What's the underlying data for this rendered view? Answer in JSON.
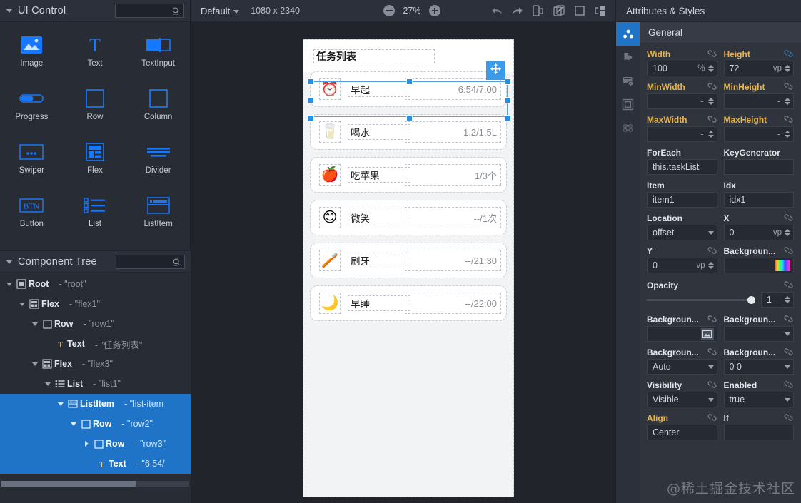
{
  "left_panel": {
    "title": "UI Control",
    "search_placeholder": "",
    "search_value": "",
    "controls": [
      {
        "name": "Image",
        "icon": "image-icon"
      },
      {
        "name": "Text",
        "icon": "text-icon"
      },
      {
        "name": "TextInput",
        "icon": "textinput-icon"
      },
      {
        "name": "Progress",
        "icon": "progress-icon"
      },
      {
        "name": "Row",
        "icon": "row-icon"
      },
      {
        "name": "Column",
        "icon": "column-icon"
      },
      {
        "name": "Swiper",
        "icon": "swiper-icon"
      },
      {
        "name": "Flex",
        "icon": "flex-icon"
      },
      {
        "name": "Divider",
        "icon": "divider-icon"
      },
      {
        "name": "Button",
        "icon": "button-icon"
      },
      {
        "name": "List",
        "icon": "list-icon"
      },
      {
        "name": "ListItem",
        "icon": "listitem-icon"
      }
    ]
  },
  "component_tree": {
    "title": "Component Tree",
    "search_value": "",
    "nodes": [
      {
        "type": "Root",
        "id": "- \"root\"",
        "depth": 0,
        "caret": "down",
        "icon": "root-icon",
        "selected": false
      },
      {
        "type": "Flex",
        "id": "- \"flex1\"",
        "depth": 1,
        "caret": "down",
        "icon": "flex-icon",
        "selected": false
      },
      {
        "type": "Row",
        "id": "- \"row1\"",
        "depth": 2,
        "caret": "down",
        "icon": "row-icon",
        "selected": false
      },
      {
        "type": "Text",
        "id": "- \"任务列表\"",
        "depth": 3,
        "caret": "none",
        "icon": "text-icon",
        "selected": false
      },
      {
        "type": "Flex",
        "id": "- \"flex3\"",
        "depth": 2,
        "caret": "down",
        "icon": "flex-icon",
        "selected": false
      },
      {
        "type": "List",
        "id": "- \"list1\"",
        "depth": 3,
        "caret": "down",
        "icon": "list-icon",
        "selected": false
      },
      {
        "type": "ListItem",
        "id": "- \"list-item",
        "depth": 4,
        "caret": "down",
        "icon": "listitem-icon",
        "selected": true
      },
      {
        "type": "Row",
        "id": "- \"row2\"",
        "depth": 5,
        "caret": "down",
        "icon": "row-icon",
        "selected": true
      },
      {
        "type": "Row",
        "id": "- \"row3\"",
        "depth": 6,
        "caret": "right",
        "icon": "row-icon",
        "selected": true
      },
      {
        "type": "Text",
        "id": "- \"6:54/",
        "depth": 6,
        "caret": "none",
        "icon": "text-icon",
        "selected": true
      }
    ]
  },
  "toolbar": {
    "device_label": "Default",
    "resolution": "1080 x 2340",
    "zoom": "27%",
    "zoom_out_label": "−",
    "zoom_in_label": "+",
    "icons": [
      "undo-icon",
      "redo-icon",
      "device-preview-icon",
      "layers-icon",
      "frame-icon",
      "split-view-icon"
    ]
  },
  "preview": {
    "title": "任务列表",
    "tasks": [
      {
        "emoji": "⏰",
        "name": "早起",
        "value": "6:54/7:00",
        "selected": true
      },
      {
        "emoji": "🥛",
        "name": "喝水",
        "value": "1.2/1.5L",
        "selected": false
      },
      {
        "emoji": "🍎",
        "name": "吃苹果",
        "value": "1/3个",
        "selected": false
      },
      {
        "emoji": "😊",
        "name": "微笑",
        "value": "--/1次",
        "selected": false
      },
      {
        "emoji": "🪥",
        "name": "刷牙",
        "value": "--/21:30",
        "selected": false
      },
      {
        "emoji": "🌙",
        "name": "早睡",
        "value": "--/22:00",
        "selected": false
      }
    ]
  },
  "right_panel": {
    "title": "Attributes & Styles",
    "section": "General",
    "rail_icons": [
      "attributes-icon",
      "puzzle-icon",
      "events-icon",
      "box-model-icon",
      "settings-icon"
    ],
    "fields": {
      "width": {
        "label": "Width",
        "value": "100",
        "unit": "%",
        "kind": "spin"
      },
      "height": {
        "label": "Height",
        "value": "72",
        "unit": "vp",
        "kind": "spin"
      },
      "min_width": {
        "label": "MinWidth",
        "value": "-",
        "unit": "",
        "kind": "spin"
      },
      "min_height": {
        "label": "MinHeight",
        "value": "-",
        "unit": "",
        "kind": "spin"
      },
      "max_width": {
        "label": "MaxWidth",
        "value": "-",
        "unit": "",
        "kind": "spin"
      },
      "max_height": {
        "label": "MaxHeight",
        "value": "-",
        "unit": "",
        "kind": "spin"
      },
      "foreach": {
        "label": "ForEach",
        "value": "this.taskList",
        "unit": "",
        "kind": "text"
      },
      "keygen": {
        "label": "KeyGenerator",
        "value": "",
        "unit": "",
        "kind": "text"
      },
      "item": {
        "label": "Item",
        "value": "item1",
        "unit": "",
        "kind": "text"
      },
      "idx": {
        "label": "Idx",
        "value": "idx1",
        "unit": "",
        "kind": "text"
      },
      "location": {
        "label": "Location",
        "value": "offset",
        "unit": "",
        "kind": "select"
      },
      "x": {
        "label": "X",
        "value": "0",
        "unit": "vp",
        "kind": "spin"
      },
      "y": {
        "label": "Y",
        "value": "0",
        "unit": "vp",
        "kind": "spin"
      },
      "bg_color": {
        "label": "Backgroun...",
        "value": "",
        "unit": "",
        "kind": "gradient"
      },
      "opacity": {
        "label": "Opacity",
        "value": "1",
        "unit": "",
        "kind": "slider"
      },
      "bg_image": {
        "label": "Backgroun...",
        "value": "",
        "unit": "",
        "kind": "image"
      },
      "bg_repeat": {
        "label": "Backgroun...",
        "value": "",
        "unit": "",
        "kind": "select"
      },
      "bg_size": {
        "label": "Backgroun...",
        "value": "Auto",
        "unit": "",
        "kind": "select"
      },
      "bg_position": {
        "label": "Backgroun...",
        "value": "0 0",
        "unit": "",
        "kind": "select"
      },
      "visibility": {
        "label": "Visibility",
        "value": "Visible",
        "unit": "",
        "kind": "select"
      },
      "enabled": {
        "label": "Enabled",
        "value": "true",
        "unit": "",
        "kind": "select"
      },
      "align": {
        "label": "Align",
        "value": "Center",
        "unit": "",
        "kind": "select"
      },
      "if": {
        "label": "If",
        "value": "",
        "unit": "",
        "kind": "text"
      }
    }
  },
  "watermark": "@稀土掘金技术社区"
}
